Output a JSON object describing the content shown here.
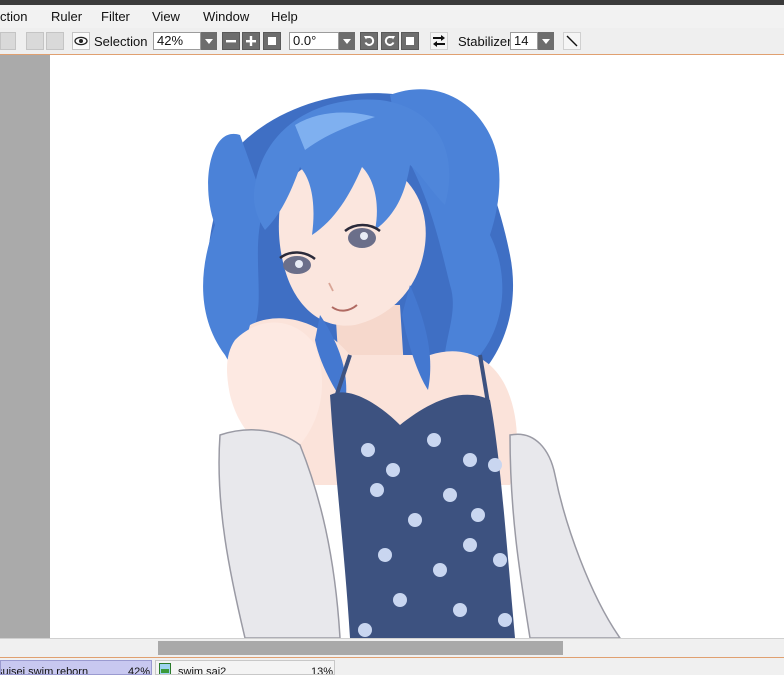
{
  "menu": {
    "items": [
      "ction",
      "Ruler",
      "Filter",
      "View",
      "Window",
      "Help"
    ]
  },
  "toolbar": {
    "selection_label": "Selection",
    "zoom_value": "42%",
    "rotation_value": "0.0°",
    "stabilizer_label": "Stabilizer",
    "stabilizer_value": "14"
  },
  "canvas": {
    "background": "#ffffff"
  },
  "tabs": [
    {
      "name": "suisei swim reborn",
      "zoom": "42%",
      "active": true
    },
    {
      "name": "swim sai2",
      "zoom": "13%",
      "active": false
    }
  ],
  "colors": {
    "accent_line": "#e0a070",
    "active_tab": "#c8c8f0",
    "hair": "#4a7fd6",
    "swimsuit": "#3d5280"
  },
  "icons": [
    "eye-icon",
    "zoom-out-icon",
    "zoom-in-icon",
    "zoom-reset-icon",
    "rotate-ccw-icon",
    "rotate-cw-icon",
    "rotate-reset-icon",
    "flip-horizontal-icon",
    "pen-tool-icon",
    "image-icon"
  ]
}
